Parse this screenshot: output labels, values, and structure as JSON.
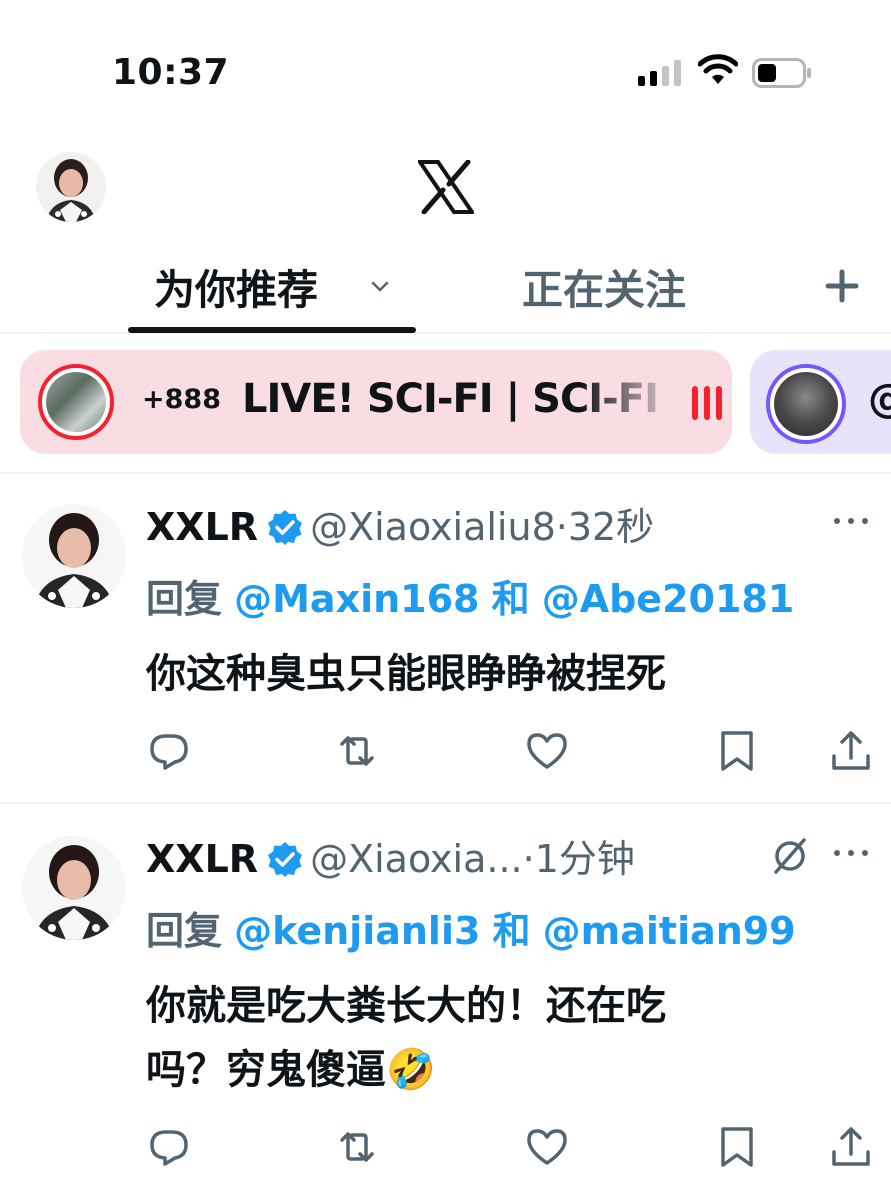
{
  "status_bar": {
    "time": "10:37"
  },
  "header": {
    "logo_icon": "x-logo-icon"
  },
  "tabs": {
    "for_you": "为你推荐",
    "following": "正在关注"
  },
  "spaces": [
    {
      "listeners": "+888",
      "title": "LIVE! SCI-FI | SCI-FI",
      "accent": "#f4212e",
      "background": "#f9dde3"
    },
    {
      "title_partial": "@",
      "accent": "#7856ff",
      "background": "#e8e3fb"
    }
  ],
  "tweets": [
    {
      "name": "XXLR",
      "handle": "@Xiaoxialiu8",
      "time": "·32秒",
      "reply_prefix": "回复",
      "mention_1": "@Maxin168",
      "reply_joiner": "和",
      "mention_2": "@Abe20181",
      "body": "你这种臭虫只能眼睁睁被捏死"
    },
    {
      "name": "XXLR",
      "handle": "@Xiaoxia...",
      "time": "·1分钟",
      "reply_prefix": "回复",
      "mention_1": "@kenjianli3",
      "reply_joiner": "和",
      "mention_2": "@maitian99",
      "body_line_1": "你就是吃大粪长大的！还在吃",
      "body_line_2": "吗？穷鬼傻逼🤣"
    }
  ],
  "colors": {
    "text_primary": "#0f1419",
    "text_secondary": "#536471",
    "link": "#1d9bf0",
    "divider": "#eff3f4"
  }
}
